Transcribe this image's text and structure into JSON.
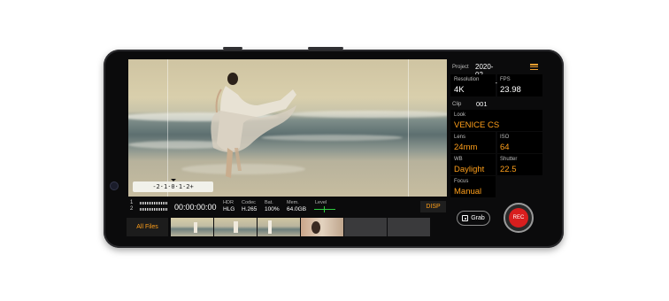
{
  "project": {
    "label": "Project",
    "value": "2020-02-25_10-35"
  },
  "clip": {
    "label": "Clip",
    "value": "001"
  },
  "settings": {
    "resolution": {
      "label": "Resolution",
      "value": "4K"
    },
    "fps": {
      "label": "FPS",
      "value": "23.98"
    },
    "look": {
      "label": "Look",
      "value": "VENICE CS"
    },
    "lens": {
      "label": "Lens",
      "value": "24mm"
    },
    "iso": {
      "label": "ISO",
      "value": "64"
    },
    "wb": {
      "label": "WB",
      "value": "Daylight"
    },
    "shutter": {
      "label": "Shutter",
      "value": "22.5"
    },
    "focus": {
      "label": "Focus",
      "value": "Manual"
    }
  },
  "status": {
    "audio_ch1": "1",
    "audio_ch2": "2",
    "timecode": "00:00:00:00",
    "hdr": {
      "label": "HDR",
      "value": "HLG"
    },
    "codec": {
      "label": "Codec",
      "value": "H.265"
    },
    "battery": {
      "label": "Bat.",
      "value": "100%"
    },
    "memory": {
      "label": "Mem.",
      "value": "64.0GB"
    },
    "level": {
      "label": "Level"
    }
  },
  "scale_text": "-2·1·0·1·2+",
  "buttons": {
    "disp": "DISP",
    "all_files": "All Files",
    "grab": "Grab",
    "rec": "REC"
  },
  "colors": {
    "accent": "#ff9f1a",
    "rec": "#d81e1e",
    "level": "#2ecc40"
  },
  "icons": [
    "menu-icon",
    "grab-icon",
    "rec-icon"
  ]
}
